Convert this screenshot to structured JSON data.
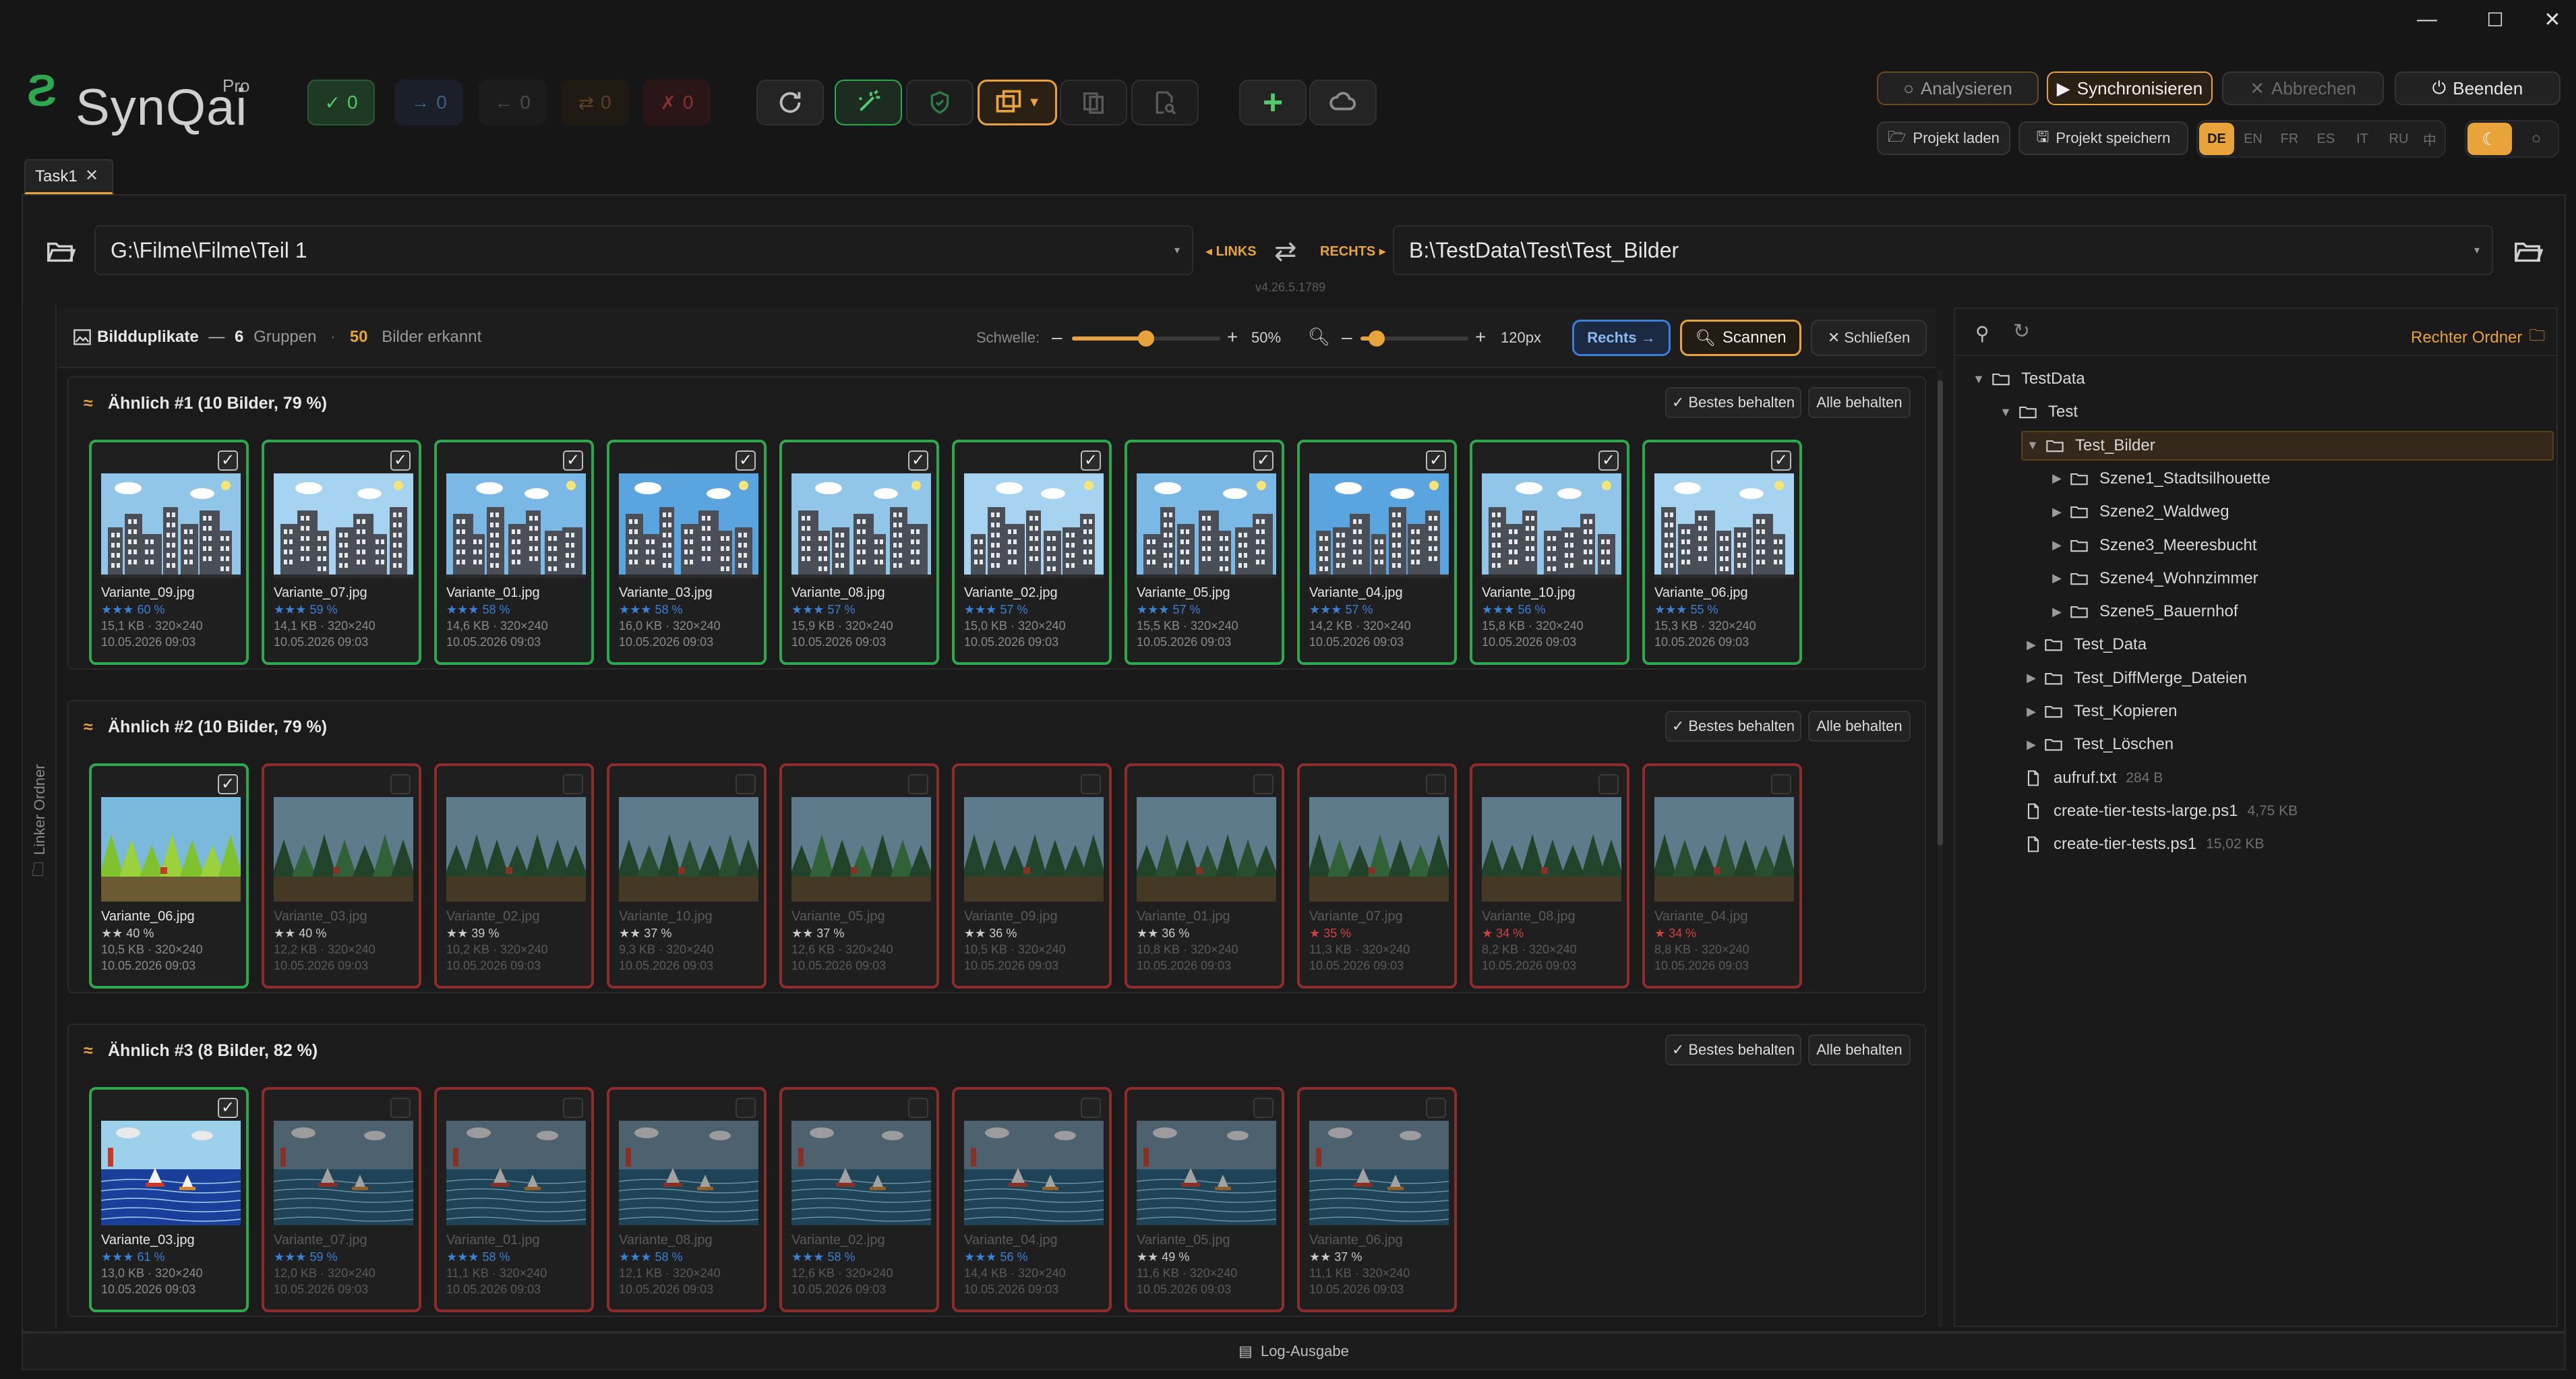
{
  "app": {
    "name": "SynQai",
    "edition": "Pro",
    "version": "v4.26.5.1789",
    "logo_char": "Ƨ"
  },
  "window_controls": {
    "minimize": "—",
    "maximize": "☐",
    "close": "✕"
  },
  "stats": [
    {
      "icon": "✓",
      "count": "0",
      "color": "#52c96a"
    },
    {
      "icon": "→",
      "count": "0",
      "color": "#3c5e8c"
    },
    {
      "icon": "←",
      "count": "0",
      "color": "#4a4a4a"
    },
    {
      "icon": "⇄",
      "count": "0",
      "color": "#5a4220"
    },
    {
      "icon": "✗",
      "count": "0",
      "color": "#6e2a2a"
    }
  ],
  "actions": {
    "analyze": "Analysieren",
    "sync": "Synchronisieren",
    "abort": "Abbrechen",
    "quit": "Beenden",
    "load_project": "Projekt laden",
    "save_project": "Projekt speichern"
  },
  "languages": [
    "DE",
    "EN",
    "FR",
    "ES",
    "IT",
    "RU",
    "中"
  ],
  "active_language": "DE",
  "tab": {
    "label": "Task1",
    "close": "✕"
  },
  "paths": {
    "left": "G:\\Filme\\Filme\\Teil 1",
    "right": "B:\\TestData\\Test\\Test_Bilder",
    "left_tag": "◂ LINKS",
    "right_tag": "RECHTS ▸",
    "swap": "⇄"
  },
  "sidebar_left": {
    "label": "Linker Ordner"
  },
  "dup_panel": {
    "title": "Bildduplikate",
    "sep": "—",
    "groups_count": "6",
    "groups_label": "Gruppen",
    "dot": "·",
    "images_count": "50",
    "images_label": "Bilder erkannt",
    "threshold_label": "Schwelle:",
    "threshold_value": 0.5,
    "threshold_text": "50%",
    "zoom_value": 0.15,
    "zoom_text": "120px",
    "minus": "–",
    "plus": "+",
    "btn_right": "Rechts →",
    "btn_scan": "Scannen",
    "btn_close": "✕ Schließen",
    "keep_best": "✓ Bestes behalten",
    "keep_all": "Alle behalten"
  },
  "groups": [
    {
      "title": "Ähnlich #1 (10 Bilder, 79 %)",
      "scene": "city",
      "cards": [
        {
          "name": "Variante_09.jpg",
          "stars": "★★★",
          "pct": "60 %",
          "size": "15,1 KB · 320×240",
          "date": "10.05.2026 09:03",
          "checked": true
        },
        {
          "name": "Variante_07.jpg",
          "stars": "★★★",
          "pct": "59 %",
          "size": "14,1 KB · 320×240",
          "date": "10.05.2026 09:03",
          "checked": true
        },
        {
          "name": "Variante_01.jpg",
          "stars": "★★★",
          "pct": "58 %",
          "size": "14,6 KB · 320×240",
          "date": "10.05.2026 09:03",
          "checked": true
        },
        {
          "name": "Variante_03.jpg",
          "stars": "★★★",
          "pct": "58 %",
          "size": "16,0 KB · 320×240",
          "date": "10.05.2026 09:03",
          "checked": true
        },
        {
          "name": "Variante_08.jpg",
          "stars": "★★★",
          "pct": "57 %",
          "size": "15,9 KB · 320×240",
          "date": "10.05.2026 09:03",
          "checked": true
        },
        {
          "name": "Variante_02.jpg",
          "stars": "★★★",
          "pct": "57 %",
          "size": "15,0 KB · 320×240",
          "date": "10.05.2026 09:03",
          "checked": true
        },
        {
          "name": "Variante_05.jpg",
          "stars": "★★★",
          "pct": "57 %",
          "size": "15,5 KB · 320×240",
          "date": "10.05.2026 09:03",
          "checked": true
        },
        {
          "name": "Variante_04.jpg",
          "stars": "★★★",
          "pct": "57 %",
          "size": "14,2 KB · 320×240",
          "date": "10.05.2026 09:03",
          "checked": true
        },
        {
          "name": "Variante_10.jpg",
          "stars": "★★★",
          "pct": "56 %",
          "size": "15,8 KB · 320×240",
          "date": "10.05.2026 09:03",
          "checked": true
        },
        {
          "name": "Variante_06.jpg",
          "stars": "★★★",
          "pct": "55 %",
          "size": "15,3 KB · 320×240",
          "date": "10.05.2026 09:03",
          "checked": true
        }
      ]
    },
    {
      "title": "Ähnlich #2 (10 Bilder, 79 %)",
      "scene": "forest",
      "cards": [
        {
          "name": "Variante_06.jpg",
          "stars": "★★",
          "pct": "40 %",
          "size": "10,5 KB · 320×240",
          "date": "10.05.2026 09:03",
          "checked": true
        },
        {
          "name": "Variante_03.jpg",
          "stars": "★★",
          "pct": "40 %",
          "size": "12,2 KB · 320×240",
          "date": "10.05.2026 09:03",
          "checked": false
        },
        {
          "name": "Variante_02.jpg",
          "stars": "★★",
          "pct": "39 %",
          "size": "10,2 KB · 320×240",
          "date": "10.05.2026 09:03",
          "checked": false
        },
        {
          "name": "Variante_10.jpg",
          "stars": "★★",
          "pct": "37 %",
          "size": "9,3 KB · 320×240",
          "date": "10.05.2026 09:03",
          "checked": false
        },
        {
          "name": "Variante_05.jpg",
          "stars": "★★",
          "pct": "37 %",
          "size": "12,6 KB · 320×240",
          "date": "10.05.2026 09:03",
          "checked": false
        },
        {
          "name": "Variante_09.jpg",
          "stars": "★★",
          "pct": "36 %",
          "size": "10,5 KB · 320×240",
          "date": "10.05.2026 09:03",
          "checked": false
        },
        {
          "name": "Variante_01.jpg",
          "stars": "★★",
          "pct": "36 %",
          "size": "10,8 KB · 320×240",
          "date": "10.05.2026 09:03",
          "checked": false
        },
        {
          "name": "Variante_07.jpg",
          "stars": "★",
          "pct": "35 %",
          "size": "11,3 KB · 320×240",
          "date": "10.05.2026 09:03",
          "checked": false
        },
        {
          "name": "Variante_08.jpg",
          "stars": "★",
          "pct": "34 %",
          "size": "8,2 KB · 320×240",
          "date": "10.05.2026 09:03",
          "checked": false
        },
        {
          "name": "Variante_04.jpg",
          "stars": "★",
          "pct": "34 %",
          "size": "8,8 KB · 320×240",
          "date": "10.05.2026 09:03",
          "checked": false
        }
      ]
    },
    {
      "title": "Ähnlich #3 (8 Bilder, 82 %)",
      "scene": "sea",
      "cards": [
        {
          "name": "Variante_03.jpg",
          "stars": "★★★",
          "pct": "61 %",
          "size": "13,0 KB · 320×240",
          "date": "10.05.2026 09:03",
          "checked": true
        },
        {
          "name": "Variante_07.jpg",
          "stars": "★★★",
          "pct": "59 %",
          "size": "12,0 KB · 320×240",
          "date": "10.05.2026 09:03",
          "checked": false
        },
        {
          "name": "Variante_01.jpg",
          "stars": "★★★",
          "pct": "58 %",
          "size": "11,1 KB · 320×240",
          "date": "10.05.2026 09:03",
          "checked": false
        },
        {
          "name": "Variante_08.jpg",
          "stars": "★★★",
          "pct": "58 %",
          "size": "12,1 KB · 320×240",
          "date": "10.05.2026 09:03",
          "checked": false
        },
        {
          "name": "Variante_02.jpg",
          "stars": "★★★",
          "pct": "58 %",
          "size": "12,6 KB · 320×240",
          "date": "10.05.2026 09:03",
          "checked": false
        },
        {
          "name": "Variante_04.jpg",
          "stars": "★★★",
          "pct": "56 %",
          "size": "14,4 KB · 320×240",
          "date": "10.05.2026 09:03",
          "checked": false
        },
        {
          "name": "Variante_05.jpg",
          "stars": "★★",
          "pct": "49 %",
          "size": "11,6 KB · 320×240",
          "date": "10.05.2026 09:03",
          "checked": false
        },
        {
          "name": "Variante_06.jpg",
          "stars": "★★",
          "pct": "37 %",
          "size": "11,1 KB · 320×240",
          "date": "10.05.2026 09:03",
          "checked": false
        }
      ]
    }
  ],
  "right_panel": {
    "title": "Rechter Ordner",
    "tree": [
      {
        "label": "TestData",
        "depth": 0,
        "type": "folder",
        "expanded": true
      },
      {
        "label": "Test",
        "depth": 1,
        "type": "folder",
        "expanded": true
      },
      {
        "label": "Test_Bilder",
        "depth": 2,
        "type": "folder",
        "expanded": true,
        "selected": true
      },
      {
        "label": "Szene1_Stadtsilhouette",
        "depth": 3,
        "type": "folder"
      },
      {
        "label": "Szene2_Waldweg",
        "depth": 3,
        "type": "folder"
      },
      {
        "label": "Szene3_Meeresbucht",
        "depth": 3,
        "type": "folder"
      },
      {
        "label": "Szene4_Wohnzimmer",
        "depth": 3,
        "type": "folder"
      },
      {
        "label": "Szene5_Bauernhof",
        "depth": 3,
        "type": "folder"
      },
      {
        "label": "Test_Data",
        "depth": 2,
        "type": "folder"
      },
      {
        "label": "Test_DiffMerge_Dateien",
        "depth": 2,
        "type": "folder"
      },
      {
        "label": "Test_Kopieren",
        "depth": 2,
        "type": "folder"
      },
      {
        "label": "Test_Löschen",
        "depth": 2,
        "type": "folder"
      },
      {
        "label": "aufruf.txt",
        "depth": 2,
        "type": "file",
        "size": "284 B"
      },
      {
        "label": "create-tier-tests-large.ps1",
        "depth": 2,
        "type": "file",
        "size": "4,75 KB"
      },
      {
        "label": "create-tier-tests.ps1",
        "depth": 2,
        "type": "file",
        "size": "15,02 KB"
      }
    ]
  },
  "bottom": {
    "log_label": "Log-Ausgabe"
  },
  "colors": {
    "accent_orange": "#e8a33a",
    "green": "#2ea84f",
    "red": "#8e2c2c",
    "blue": "#3c7fd6",
    "bg": "#161616"
  }
}
